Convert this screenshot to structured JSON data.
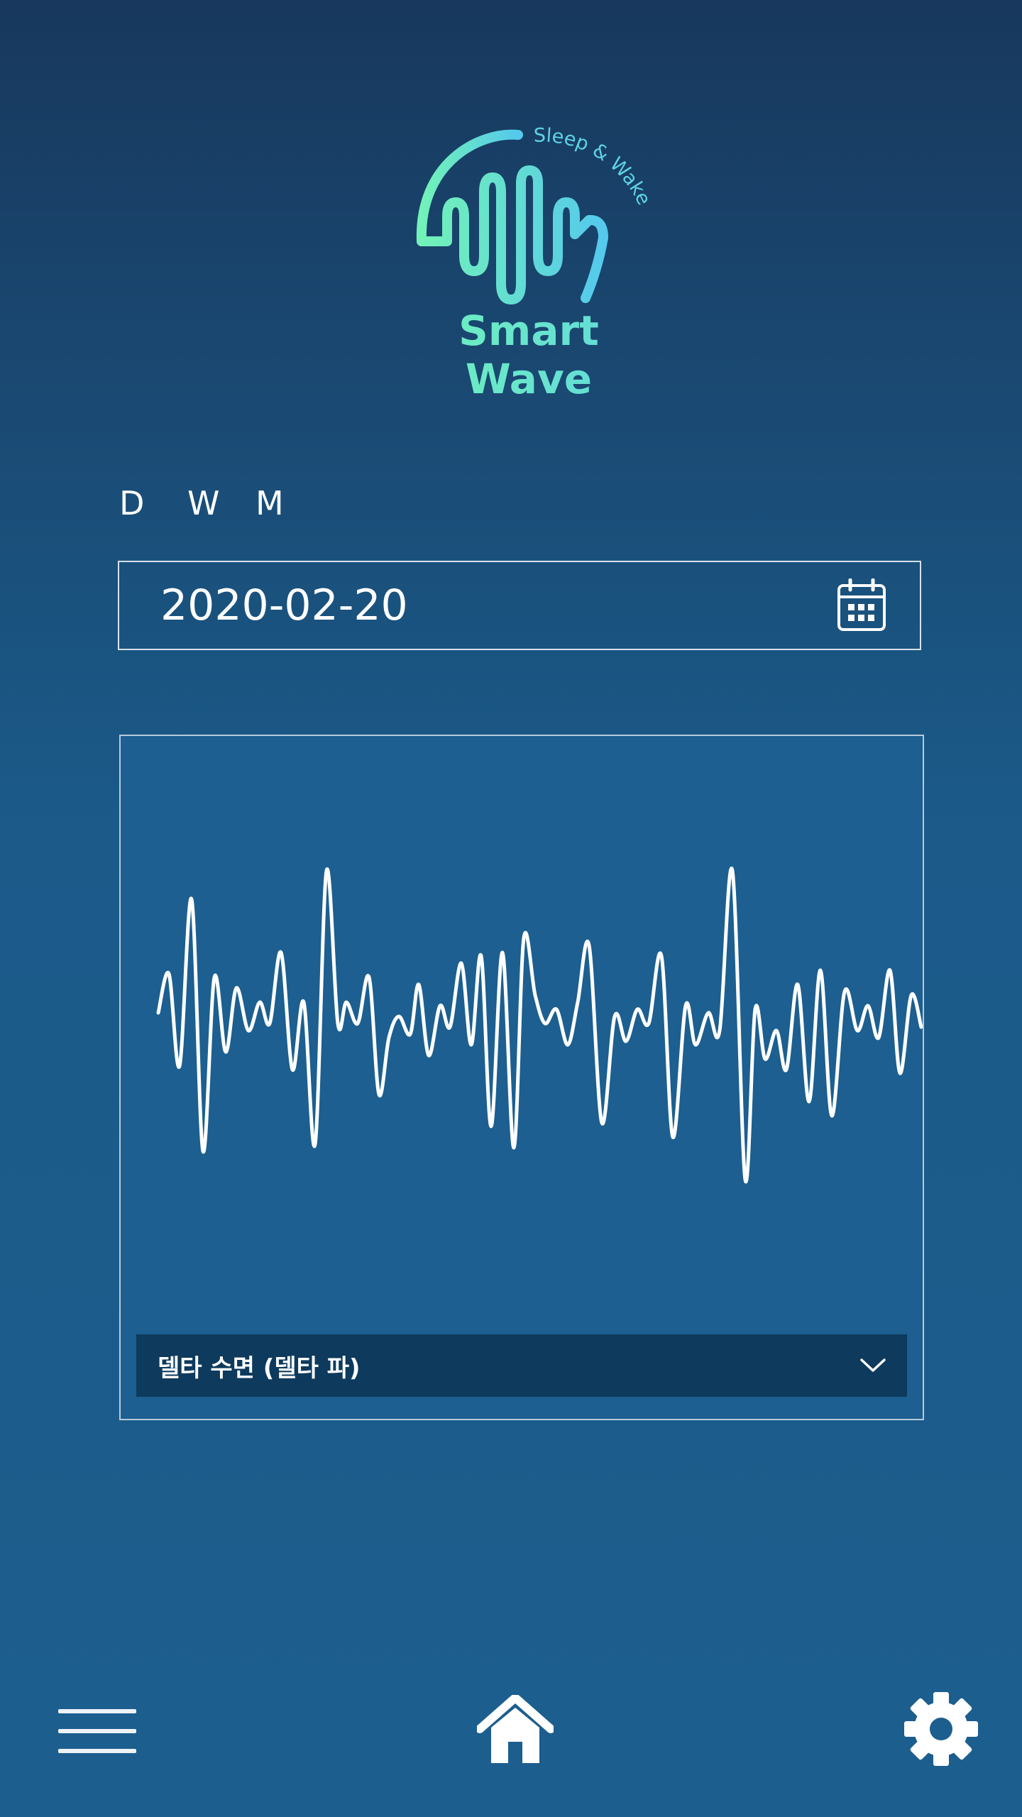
{
  "app": {
    "logo_tagline": "Sleep & Wake",
    "logo_name": "Smart Wave"
  },
  "period_tabs": [
    {
      "label": "D"
    },
    {
      "label": "W"
    },
    {
      "label": "M"
    }
  ],
  "date_picker": {
    "value": "2020-02-20",
    "icon": "calendar-icon"
  },
  "wave_panel": {
    "selected_wave": "델타 수면 (델타 파)",
    "dropdown_icon": "chevron-down-icon"
  },
  "bottom_nav": {
    "menu_icon": "menu-icon",
    "home_icon": "home-icon",
    "settings_icon": "gear-icon"
  },
  "colors": {
    "background_top": "#18385d",
    "background_bottom": "#1c5e8e",
    "logo_green": "#6ff0bd",
    "logo_cyan": "#5fd0e8",
    "select_bg": "#0d3a5d",
    "wave_stroke": "#ffffff"
  }
}
